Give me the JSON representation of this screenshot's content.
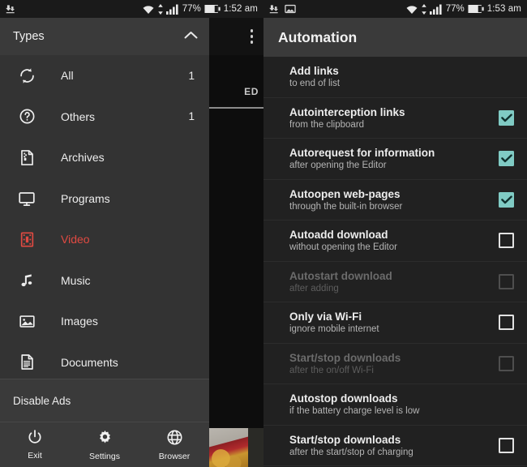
{
  "left": {
    "statusbar": {
      "icons": [
        "download-icon"
      ],
      "wifi_icon": "wifi-icon",
      "signal_icon": "signal-icon",
      "battery_percent": "77%",
      "battery_icon": "battery-icon",
      "time": "1:52 am"
    },
    "background": {
      "tab_label_partial": "ED",
      "overflow_icon": "overflow-menu-icon"
    },
    "drawer": {
      "title": "Types",
      "collapse_icon": "chevron-up-icon",
      "items": [
        {
          "label": "All",
          "icon": "sync-icon",
          "count": "1"
        },
        {
          "label": "Others",
          "icon": "question-icon",
          "count": "1"
        },
        {
          "label": "Archives",
          "icon": "archive-icon",
          "count": ""
        },
        {
          "label": "Programs",
          "icon": "monitor-icon",
          "count": ""
        },
        {
          "label": "Video",
          "icon": "film-icon",
          "count": "",
          "active": true
        },
        {
          "label": "Music",
          "icon": "music-note-icon",
          "count": ""
        },
        {
          "label": "Images",
          "icon": "image-icon",
          "count": ""
        },
        {
          "label": "Documents",
          "icon": "document-icon",
          "count": ""
        }
      ],
      "disable_ads_label": "Disable Ads",
      "bottom_bar": [
        {
          "label": "Exit",
          "icon": "power-icon"
        },
        {
          "label": "Settings",
          "icon": "gear-icon"
        },
        {
          "label": "Browser",
          "icon": "globe-icon"
        }
      ]
    }
  },
  "right": {
    "statusbar": {
      "icons": [
        "download-icon",
        "photo-icon"
      ],
      "wifi_icon": "wifi-icon",
      "signal_icon": "signal-icon",
      "battery_percent": "77%",
      "battery_icon": "battery-icon",
      "time": "1:53 am"
    },
    "header": {
      "title": "Automation"
    },
    "settings": [
      {
        "title": "Add links",
        "subtitle": "to end of list",
        "checkbox": "none",
        "enabled": true
      },
      {
        "title": "Autointerception links",
        "subtitle": "from the clipboard",
        "checkbox": "checked",
        "enabled": true
      },
      {
        "title": "Autorequest for information",
        "subtitle": "after opening the Editor",
        "checkbox": "checked",
        "enabled": true
      },
      {
        "title": "Autoopen web-pages",
        "subtitle": "through the built-in browser",
        "checkbox": "checked",
        "enabled": true
      },
      {
        "title": "Autoadd download",
        "subtitle": "without opening the Editor",
        "checkbox": "unchecked",
        "enabled": true
      },
      {
        "title": "Autostart download",
        "subtitle": "after adding",
        "checkbox": "unchecked",
        "enabled": false
      },
      {
        "title": "Only via Wi-Fi",
        "subtitle": "ignore mobile internet",
        "checkbox": "unchecked",
        "enabled": true
      },
      {
        "title": "Start/stop downloads",
        "subtitle": "after the on/off Wi-Fi",
        "checkbox": "unchecked",
        "enabled": false
      },
      {
        "title": "Autostop downloads",
        "subtitle": "if the battery charge level is low",
        "checkbox": "none",
        "enabled": true
      },
      {
        "title": "Start/stop downloads",
        "subtitle": "after the start/stop of charging",
        "checkbox": "unchecked",
        "enabled": true
      }
    ]
  },
  "colors": {
    "accent_red": "#e04a42",
    "checkbox_teal": "#80cbc4",
    "drawer_bg": "#333333",
    "panel_bg": "#212121"
  }
}
